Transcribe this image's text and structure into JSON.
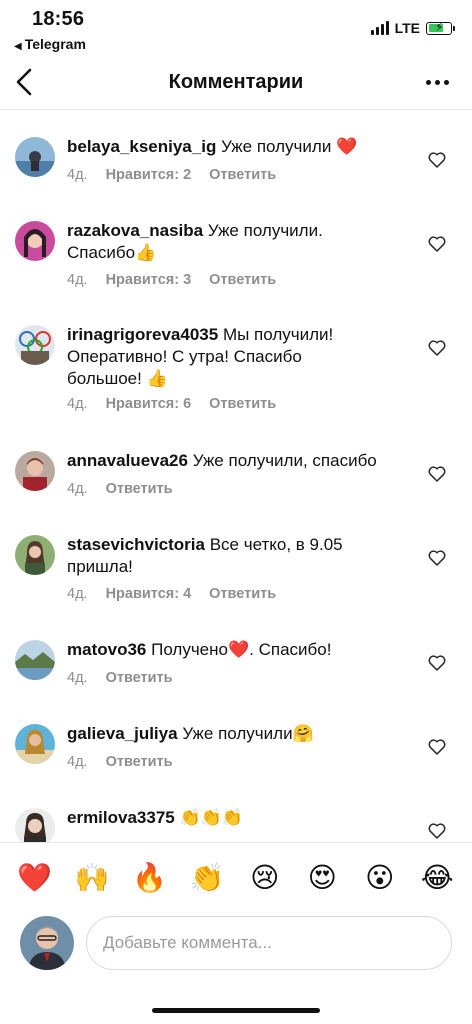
{
  "status": {
    "time": "18:56",
    "back_app": "Telegram",
    "network": "LTE"
  },
  "header": {
    "title": "Комментарии"
  },
  "comments": [
    {
      "user": "belaya_kseniya_ig",
      "text": "Уже получили",
      "emoji": "❤️",
      "time": "4д.",
      "likes": "Нравится: 2",
      "reply": "Ответить"
    },
    {
      "user": "razakova_nasiba",
      "text": "Уже получили.",
      "text2": "Спасибо",
      "emoji": "👍",
      "time": "4д.",
      "likes": "Нравится: 3",
      "reply": "Ответить"
    },
    {
      "user": "irinagrigoreva4035",
      "text": "Мы получили!",
      "text2": "Оперативно! С утра! Спасибо",
      "text3": "большое!",
      "emoji": "👍",
      "time": "4д.",
      "likes": "Нравится: 6",
      "reply": "Ответить"
    },
    {
      "user": "annavalueva26",
      "text": "Уже получили, спасибо",
      "time": "4д.",
      "reply": "Ответить"
    },
    {
      "user": "stasevichvictoria",
      "text": "Все четко, в 9.05",
      "text2": "пришла!",
      "time": "4д.",
      "likes": "Нравится: 4",
      "reply": "Ответить"
    },
    {
      "user": "matovo36",
      "text": "Получено",
      "emoji": "❤️",
      "text_after": ". Спасибо!",
      "time": "4д.",
      "reply": "Ответить"
    },
    {
      "user": "galieva_juliya",
      "text": "Уже получили",
      "emoji": "🤗",
      "time": "4д.",
      "reply": "Ответить"
    },
    {
      "user": "ermilova3375",
      "emoji": "👏👏👏"
    }
  ],
  "emoji_bar": [
    "❤️",
    "🙌",
    "🔥",
    "👏",
    "😢",
    "😍",
    "😮",
    "😂"
  ],
  "input": {
    "placeholder": "Добавьте коммента..."
  },
  "colors": {
    "meta_gray": "#8e8e8e",
    "heart_red": "#ed4956",
    "battery_green": "#35c759"
  }
}
